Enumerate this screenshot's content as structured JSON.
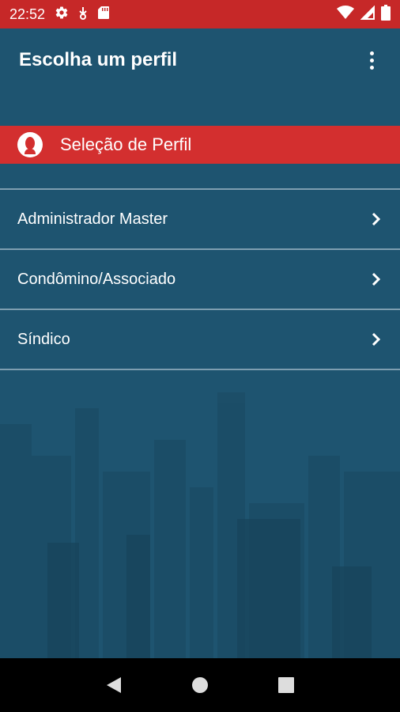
{
  "status_bar": {
    "time": "22:52",
    "left_icons": [
      "gear-icon",
      "download-icon",
      "sd-card-icon"
    ],
    "right_icons": [
      "wifi-icon",
      "signal-icon",
      "battery-icon"
    ]
  },
  "toolbar": {
    "title": "Escolha um perfil",
    "overflow_icon": "more-vert-icon"
  },
  "section": {
    "title": "Seleção de Perfil",
    "icon": "person-icon"
  },
  "profiles": [
    {
      "label": "Administrador Master"
    },
    {
      "label": "Condômino/Associado"
    },
    {
      "label": "Síndico"
    }
  ],
  "nav_bar": {
    "buttons": [
      "back-icon",
      "home-icon",
      "recents-icon"
    ]
  },
  "colors": {
    "status_bar": "#c62828",
    "background": "#1e5470",
    "section_header": "#d32f2f",
    "text": "#ffffff"
  }
}
